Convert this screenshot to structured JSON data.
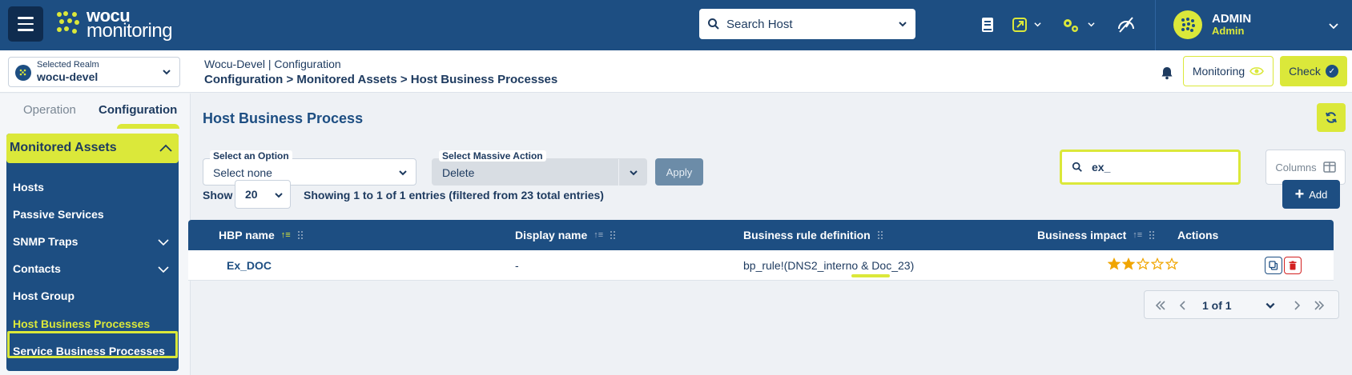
{
  "brand": {
    "line1": "wocu",
    "line2": "monitoring"
  },
  "topbar": {
    "search_label": "Search Host",
    "user": {
      "name": "ADMIN",
      "role": "Admin"
    }
  },
  "realm": {
    "label": "Selected Realm",
    "value": "wocu-devel"
  },
  "breadcrumb": {
    "top": "Wocu-Devel | Configuration",
    "path": "Configuration > Monitored Assets > Host Business Processes"
  },
  "header_buttons": {
    "monitoring": "Monitoring",
    "check": "Check"
  },
  "sidebar": {
    "tabs": [
      "Operation",
      "Configuration"
    ],
    "section": "Monitored Assets",
    "items": [
      {
        "label": "Hosts"
      },
      {
        "label": "Passive Services"
      },
      {
        "label": "SNMP Traps"
      },
      {
        "label": "Contacts"
      },
      {
        "label": "Host Group"
      },
      {
        "label": "Host Business Processes"
      },
      {
        "label": "Service Business Processes"
      }
    ]
  },
  "main": {
    "title": "Host Business Process",
    "option_select": {
      "label": "Select an Option",
      "value": "Select none"
    },
    "massive_action": {
      "label": "Select Massive Action",
      "value": "Delete"
    },
    "apply_label": "Apply",
    "filter_value": "ex_",
    "columns_label": "Columns",
    "show_label": "Show",
    "page_size": "20",
    "entries_text": "Showing 1 to 1 of 1 entries (filtered from 23 total entries)",
    "add_label": "Add",
    "table": {
      "columns": [
        "HBP name",
        "Display name",
        "Business rule definition",
        "Business impact",
        "Actions"
      ],
      "rows": [
        {
          "name": "Ex_DOC",
          "display": "-",
          "rule": "bp_rule!(DNS2_interno & Doc_23)",
          "impact": 2,
          "impact_max": 5
        }
      ]
    },
    "pagination": {
      "current": "1 of 1"
    }
  },
  "colors": {
    "primary": "#1d4e82",
    "accent": "#dbe83a",
    "danger": "#d32020"
  }
}
